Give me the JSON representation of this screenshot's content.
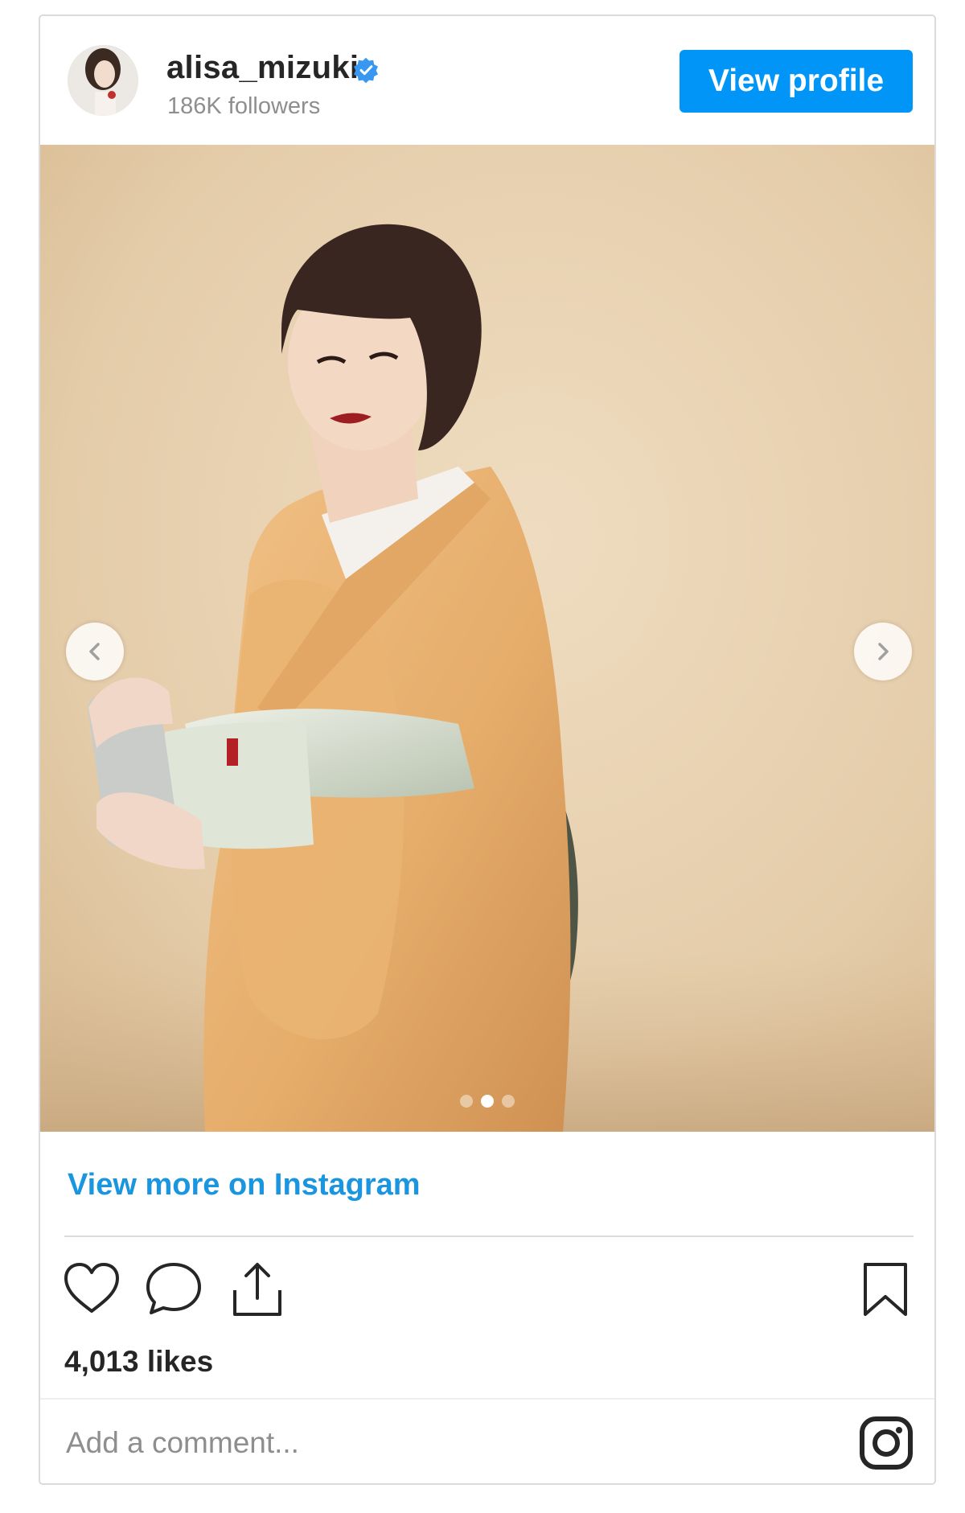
{
  "header": {
    "username": "alisa_mizuki",
    "followers": "186K followers",
    "view_profile_label": "View profile",
    "verified": true
  },
  "carousel": {
    "slide_count": 3,
    "active_slide": 2
  },
  "footer": {
    "view_more_label": "View more on Instagram",
    "likes": "4,013 likes",
    "comment_placeholder": "Add a comment..."
  },
  "icons": {
    "verified": "verified-badge-icon",
    "prev": "chevron-left-icon",
    "next": "chevron-right-icon",
    "like": "heart-icon",
    "comment": "comment-bubble-icon",
    "share": "share-icon",
    "save": "bookmark-icon",
    "logo": "instagram-logo-icon"
  },
  "colors": {
    "accent": "#0095f6",
    "link": "#1a95e0",
    "background": "#e6d1b2",
    "kimono": "#e8b06c"
  }
}
